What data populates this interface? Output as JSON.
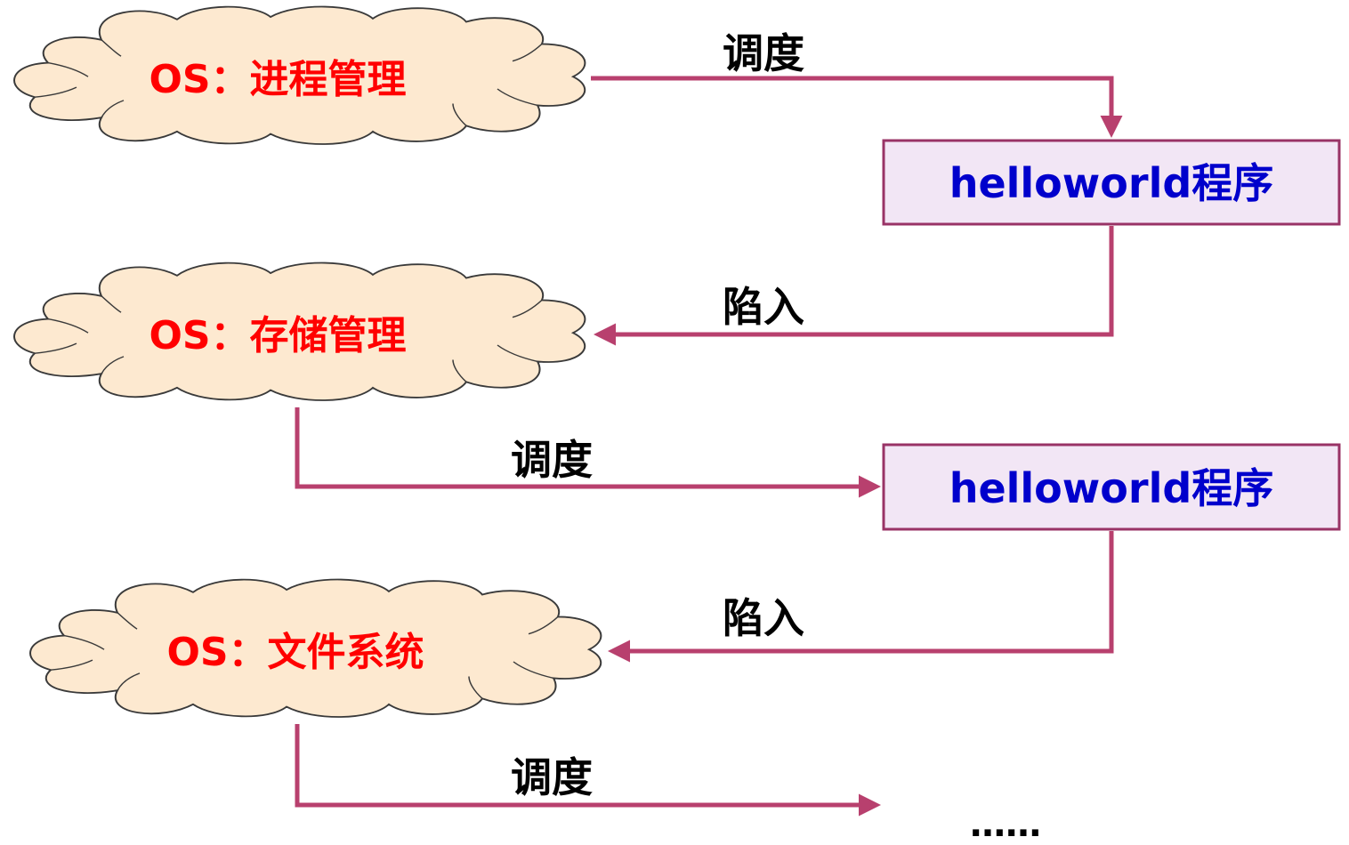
{
  "colors": {
    "cloud_fill": "#fde9d0",
    "cloud_stroke": "#3a3a3a",
    "os_text": "#ff0000",
    "box_fill": "#f2e6f5",
    "box_stroke": "#993366",
    "box_text": "#0000cc",
    "arrow": "#b8406e",
    "edge_text": "#000000"
  },
  "clouds": [
    {
      "label": "OS：进程管理"
    },
    {
      "label": "OS：存储管理"
    },
    {
      "label": "OS：文件系统"
    }
  ],
  "programs": [
    {
      "label": "helloworld程序"
    },
    {
      "label": "helloworld程序"
    }
  ],
  "edges": [
    {
      "label": "调度"
    },
    {
      "label": "陷入"
    },
    {
      "label": "调度"
    },
    {
      "label": "陷入"
    },
    {
      "label": "调度"
    }
  ],
  "continuation": "……"
}
